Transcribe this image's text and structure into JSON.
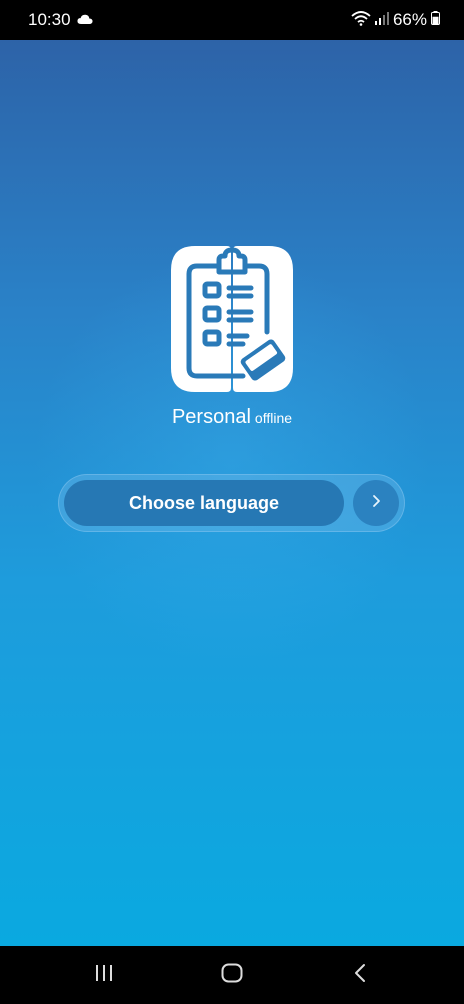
{
  "status_bar": {
    "time": "10:30",
    "cloud_icon": "cloud-icon",
    "wifi_icon": "wifi-icon",
    "signal_icon": "signal-icon",
    "battery_percent": "66%",
    "battery_icon": "battery-icon",
    "battery_level": 0.66
  },
  "app": {
    "name": "Personal",
    "subtitle": "offline",
    "logo_icon": "clipboard-checklist-icon"
  },
  "language": {
    "button_label": "Choose language",
    "next_icon": "chevron-right-icon"
  },
  "nav": {
    "recents_icon": "recents-icon",
    "home_icon": "home-icon",
    "back_icon": "back-icon"
  },
  "colors": {
    "background_top": "#2d63a8",
    "background_bottom": "#0aa9e0",
    "button": "#2678b4",
    "logo_bg": "#ffffff",
    "logo_stroke": "#2a7ab8"
  }
}
